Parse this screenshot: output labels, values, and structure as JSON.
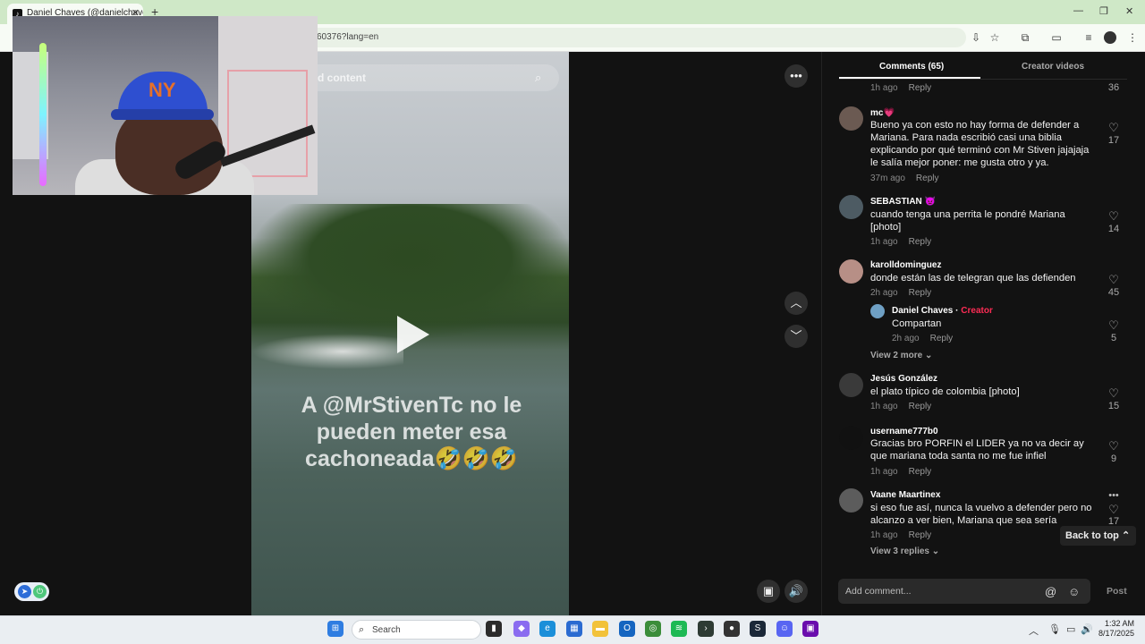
{
  "browser": {
    "tab_title": "Daniel Chaves (@danielchaves",
    "url_fragment": "60376?lang=en"
  },
  "video": {
    "search_placeholder": "d content",
    "caption": "A @MrStivenTc  no le pueden meter esa cachoneada🤣🤣🤣"
  },
  "cam": {
    "cap_logo": "NY"
  },
  "panel": {
    "tab_comments": "Comments (65)",
    "tab_creator_videos": "Creator videos",
    "back_to_top": "Back to top",
    "add_comment_placeholder": "Add comment...",
    "post": "Post",
    "reply_label": "Reply"
  },
  "comments": [
    {
      "time": "1h ago",
      "likes": "36"
    },
    {
      "user": "mc💗",
      "text": "Bueno ya con esto no hay forma de defender a Mariana. Para nada escribió casi una biblia explicando por qué terminó con Mr Stiven jajajaja le salía mejor poner: me gusta otro y ya.",
      "time": "37m ago",
      "likes": "17"
    },
    {
      "user": "SEBASTIAN 👿",
      "text": "cuando tenga una perrita le pondré Mariana [photo]",
      "time": "1h ago",
      "likes": "14"
    },
    {
      "user": "karolldominguez",
      "text": "donde están las de telegran que las defienden",
      "time": "2h ago",
      "likes": "45"
    },
    {
      "user": "Daniel Chaves",
      "creator_tag": "Creator",
      "text": "Compartan",
      "time": "2h ago",
      "likes": "5"
    },
    {
      "user": "Jesús González",
      "text": "el plato típico de colombia [photo]",
      "time": "1h ago",
      "likes": "15"
    },
    {
      "user": "username777b0",
      "text": "Gracias bro PORFIN el LIDER ya no va decir ay que mariana toda santa no me fue infiel",
      "time": "1h ago",
      "likes": "9"
    },
    {
      "user": "Vaane Maartinex",
      "text": "si eso fue así, nunca la vuelvo a defender pero no alcanzo a ver bien, Mariana que sea sería",
      "time": "1h ago",
      "likes": "17"
    }
  ],
  "view_more": {
    "replies_2": "View 2 more",
    "replies_3": "View 3 replies"
  },
  "taskbar": {
    "search": "Search",
    "time": "1:32 AM",
    "date": "8/17/2025"
  }
}
